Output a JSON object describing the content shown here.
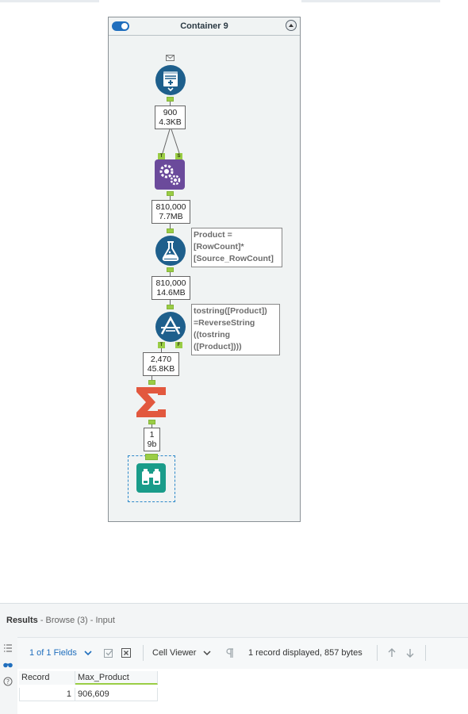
{
  "container": {
    "title": "Container 9"
  },
  "workflow": {
    "counts": [
      {
        "records": "900",
        "size": "4.3KB"
      },
      {
        "records": "810,000",
        "size": "7.7MB"
      },
      {
        "records": "810,000",
        "size": "14.6MB"
      },
      {
        "records": "2,470",
        "size": "45.8KB"
      },
      {
        "records": "1",
        "size": "9b"
      }
    ],
    "anchors": {
      "append_t": "T",
      "append_s": "S",
      "filter_t": "T",
      "filter_f": "F"
    },
    "annotations": {
      "formula": [
        "Product =",
        "[RowCount]*",
        "[Source_RowCount]"
      ],
      "filter": [
        "tostring([Product])",
        "=ReverseString",
        "((tostring",
        "([Product])))"
      ]
    },
    "icons": {
      "input": "text-input-icon",
      "append": "append-fields-icon",
      "formula": "formula-icon",
      "filter": "filter-icon",
      "summarize": "summarize-icon",
      "browse": "browse-icon"
    },
    "colors": {
      "input": "#1e5f8c",
      "append": "#6b4a9b",
      "formula": "#1e5f8c",
      "filter": "#1e5f8c",
      "summarize": "#e2583e",
      "browse": "#1a9c8a",
      "anchor": "#9acd45"
    }
  },
  "results": {
    "title": "Results",
    "subtitle": "- Browse (3) - Input",
    "fields_label": "1 of 1 Fields",
    "viewer_label": "Cell Viewer",
    "status": "1 record displayed, 857 bytes",
    "columns": [
      "Record",
      "Max_Product"
    ],
    "rows": [
      {
        "record": "1",
        "max_product": "906,609"
      }
    ]
  }
}
